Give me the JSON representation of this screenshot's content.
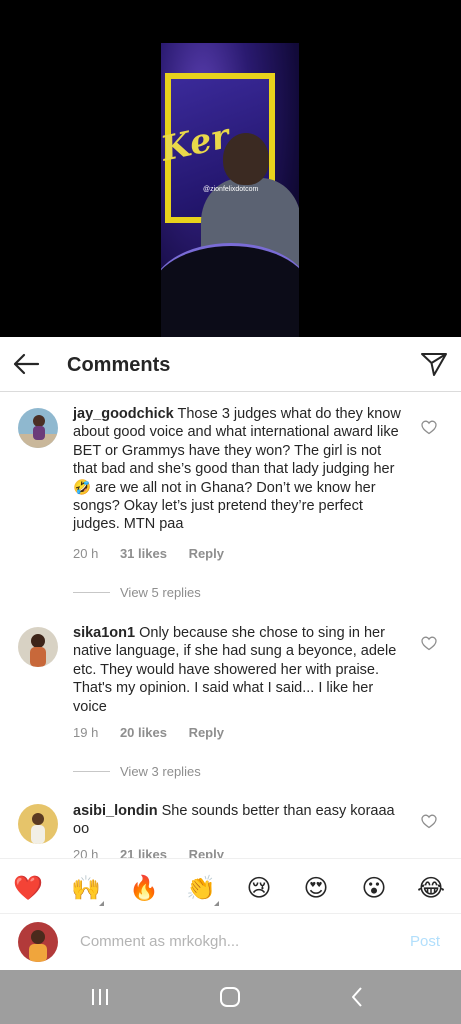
{
  "video": {
    "watermark": "@zionfelixdotcom",
    "stage_text": "Ker"
  },
  "header": {
    "title": "Comments",
    "back_icon": "arrow-left-icon",
    "share_icon": "paper-plane-icon"
  },
  "comments": [
    {
      "username": "jay_goodchick",
      "text": "Those 3 judges what do they know about good voice and what international award like BET or Grammys have they won? The girl is not that bad and she’s good than that lady judging her🤣 are we all not in Ghana? Don’t we know her songs? Okay let’s just pretend they’re perfect judges. MTN paa",
      "time": "20 h",
      "likes": "31 likes",
      "reply": "Reply",
      "view_replies": "View 5 replies"
    },
    {
      "username": "sika1on1",
      "text": "Only because she chose to sing in her native language, if she had sung a beyonce, adele etc. They would have showered her with praise. That's my opinion. I said what I said... I like her voice",
      "time": "19 h",
      "likes": "20 likes",
      "reply": "Reply",
      "view_replies": "View 3 replies"
    },
    {
      "username": "asibi_londin",
      "text": "She sounds better than easy koraaa oo",
      "time": "20 h",
      "likes": "21 likes",
      "reply": "Reply"
    }
  ],
  "reactions": [
    "❤️",
    "🙌",
    "🔥",
    "👏",
    "😢",
    "😍",
    "😮",
    "😂"
  ],
  "compose": {
    "placeholder": "Comment as mrkokgh...",
    "post_label": "Post"
  },
  "colors": {
    "post_disabled": "#b2dffc",
    "nav_bar": "#9e9e9e",
    "secondary_text": "#8e8e8e"
  },
  "navigation": {
    "recents_icon": "recents-icon",
    "home_icon": "home-icon",
    "back_icon": "nav-back-icon"
  }
}
